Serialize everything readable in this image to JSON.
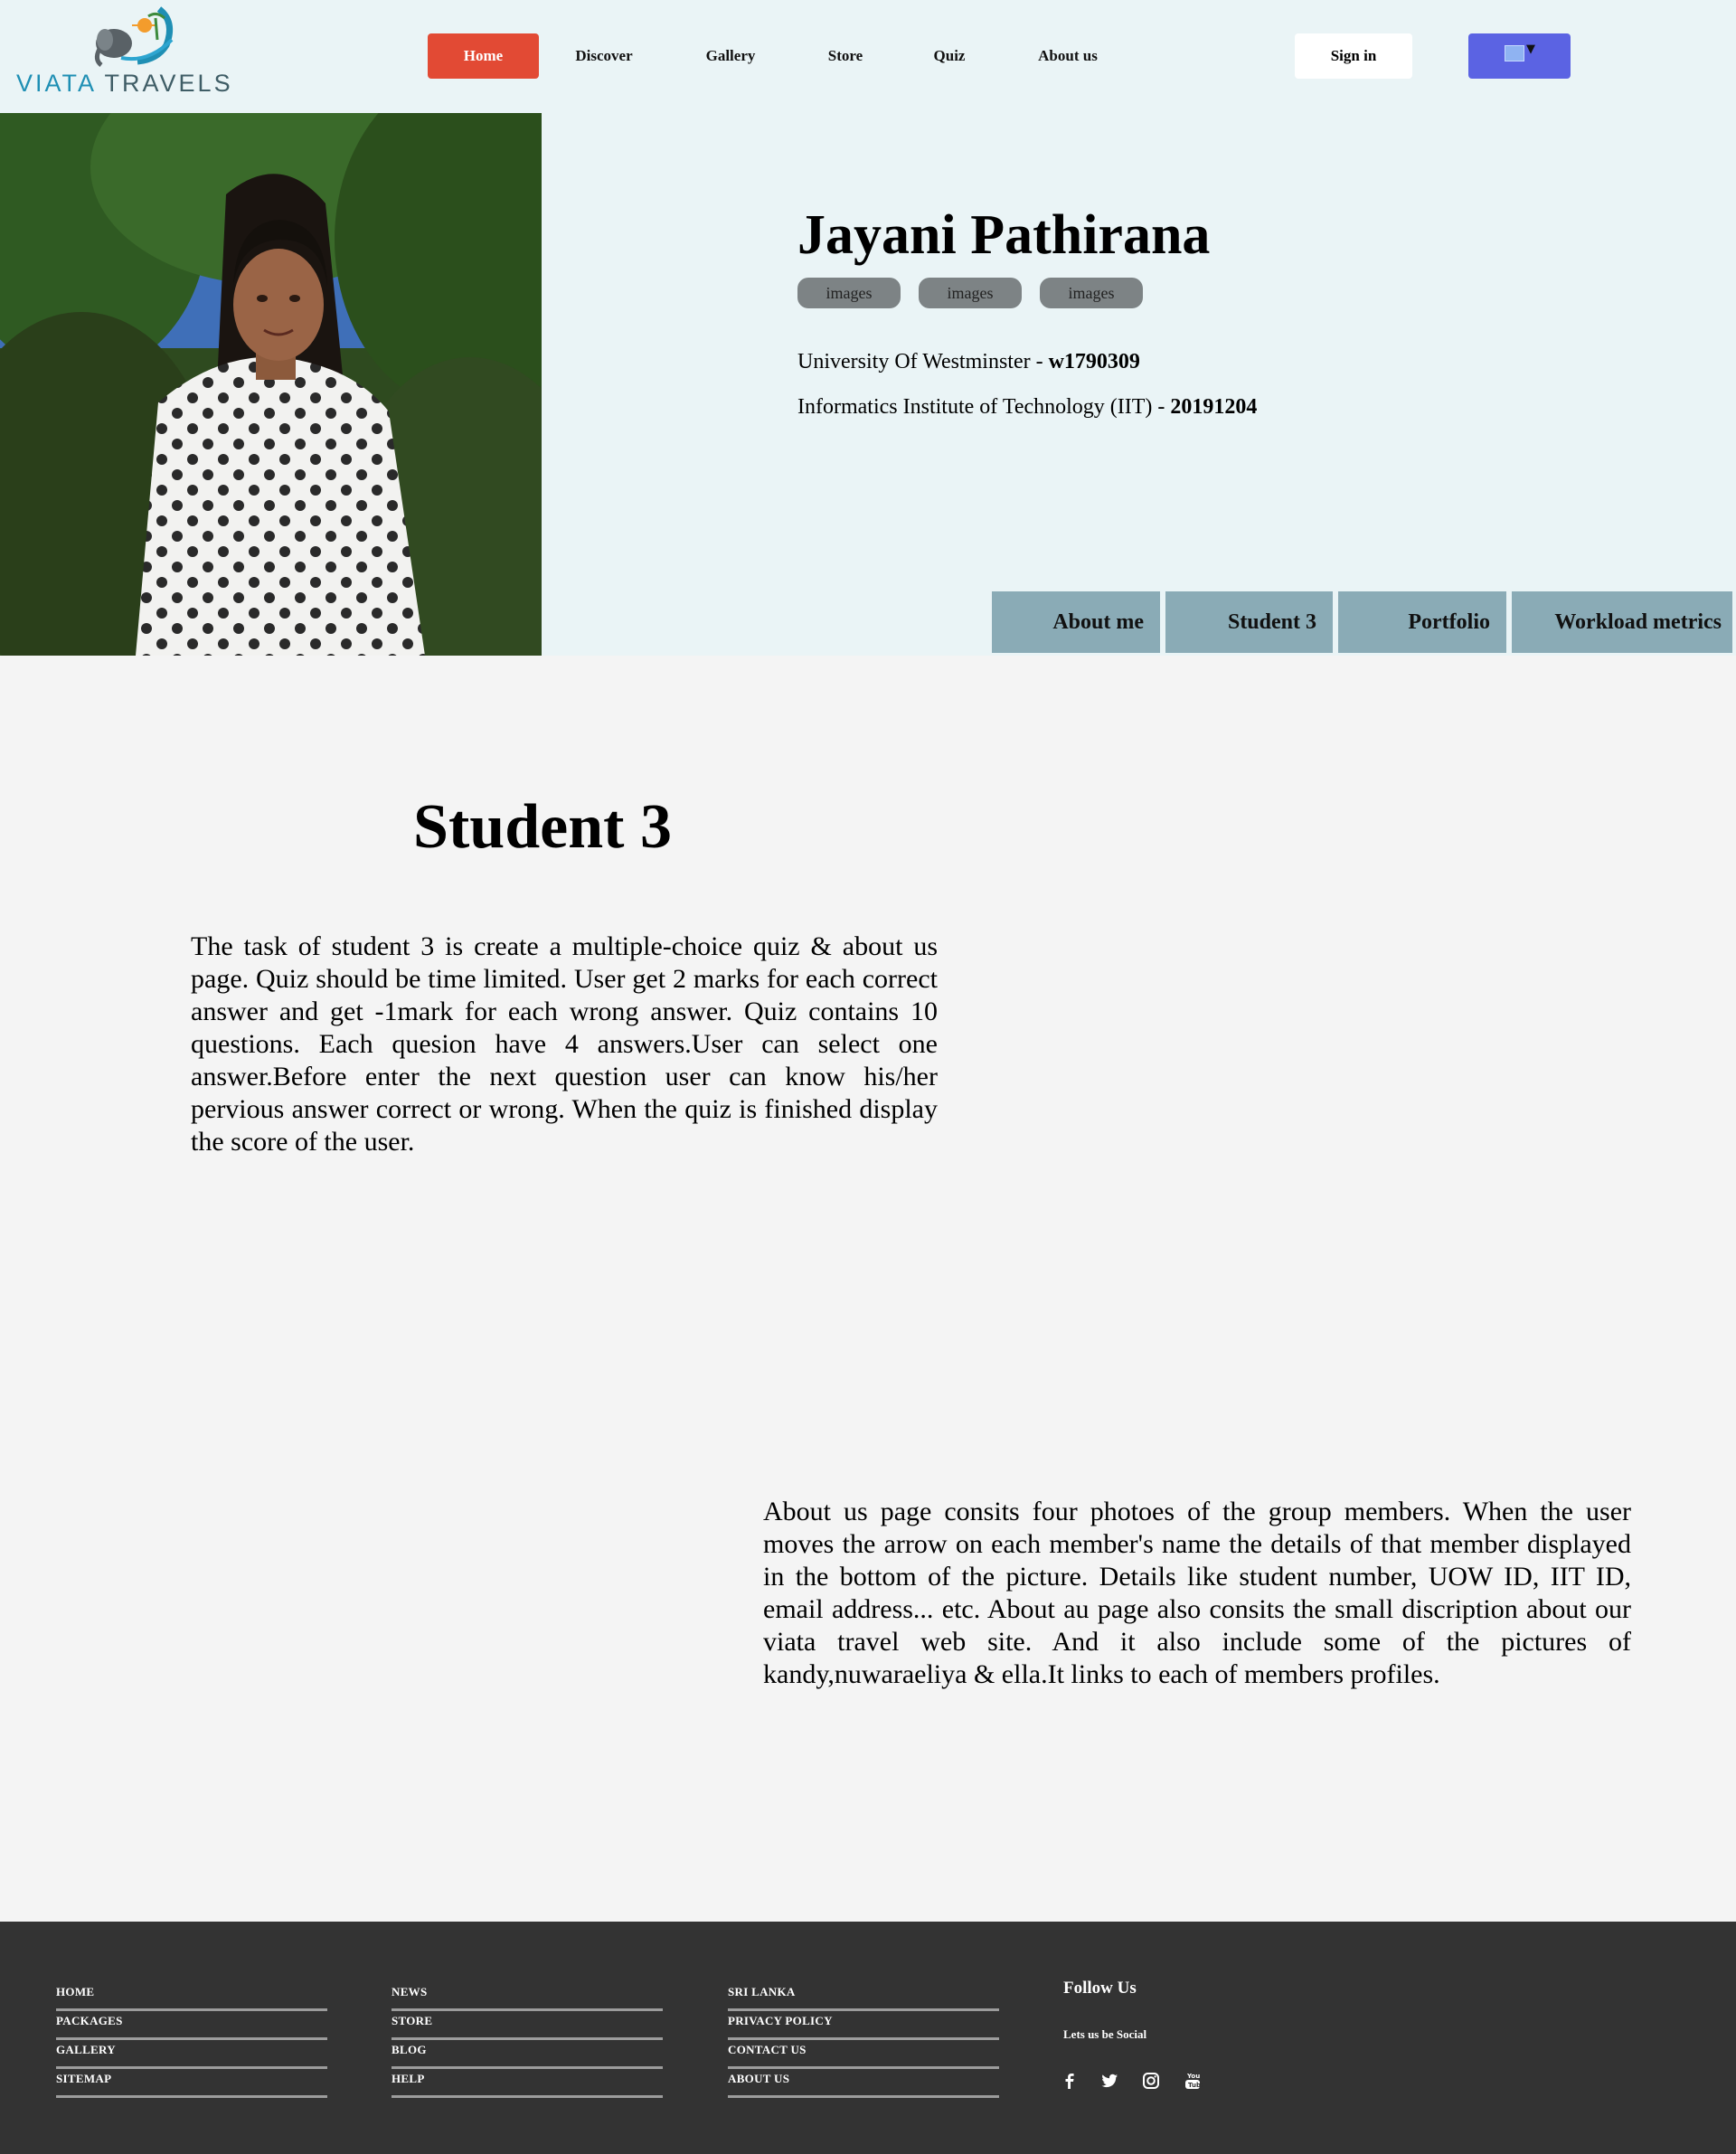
{
  "brand": {
    "logo_word_1": "VIATA",
    "logo_word_2": "TRAVELS"
  },
  "nav": {
    "items": [
      {
        "label": "Home",
        "active": true
      },
      {
        "label": "Discover"
      },
      {
        "label": "Gallery"
      },
      {
        "label": "Store"
      },
      {
        "label": "Quiz"
      },
      {
        "label": "About us"
      }
    ],
    "signin_label": "Sign in",
    "language_icon": "translate-flag-icon"
  },
  "profile": {
    "name": "Jayani Pathirana",
    "tags": [
      "images",
      "images",
      "images"
    ],
    "uni_line": {
      "text": "University Of Westminster - ",
      "id": "w1790309"
    },
    "iit_line": {
      "text": "Informatics Institute of Technology (IIT) - ",
      "id": "20191204"
    },
    "tabs": [
      "About me",
      "Student 3",
      "Portfolio",
      "Workload metrics"
    ]
  },
  "main": {
    "title": "Student 3",
    "paragraph_1": "The task of student 3 is create a multiple-choice quiz & about us page. Quiz should be time limited. User get 2 marks for each correct answer and get -1mark for each wrong answer. Quiz contains 10 questions. Each quesion have 4 answers.User can select one answer.Before enter the next question user can know his/her pervious answer correct or wrong. When the quiz is finished display the score of the user.",
    "paragraph_2": "About us page consits four photoes of the group members. When the user moves the arrow on each member's name the details of that member displayed in the bottom of the picture. Details like student number, UOW ID, IIT ID, email address... etc. About au page also consits the small discription about our viata travel web site. And it also include some of the pictures of kandy,nuwaraeliya & ella.It links to each of members profiles."
  },
  "footer": {
    "col1": [
      "HOME",
      "PACKAGES",
      "GALLERY",
      "SITEMAP"
    ],
    "col2": [
      "NEWS",
      "STORE",
      "BLOG",
      "HELP"
    ],
    "col3": [
      "SRI LANKA",
      "PRIVACY POLICY",
      "CONTACT US",
      "ABOUT US"
    ],
    "follow_title": "Follow Us",
    "follow_sub": "Lets us be Social",
    "social_icons": [
      "facebook-icon",
      "twitter-icon",
      "instagram-icon",
      "youtube-icon"
    ]
  },
  "colors": {
    "header_bg": "#eaf4f6",
    "active_nav": "#e24a34",
    "language_button": "#5b63e3",
    "tab_bg": "#8aabb6",
    "footer_bg": "#333333"
  }
}
